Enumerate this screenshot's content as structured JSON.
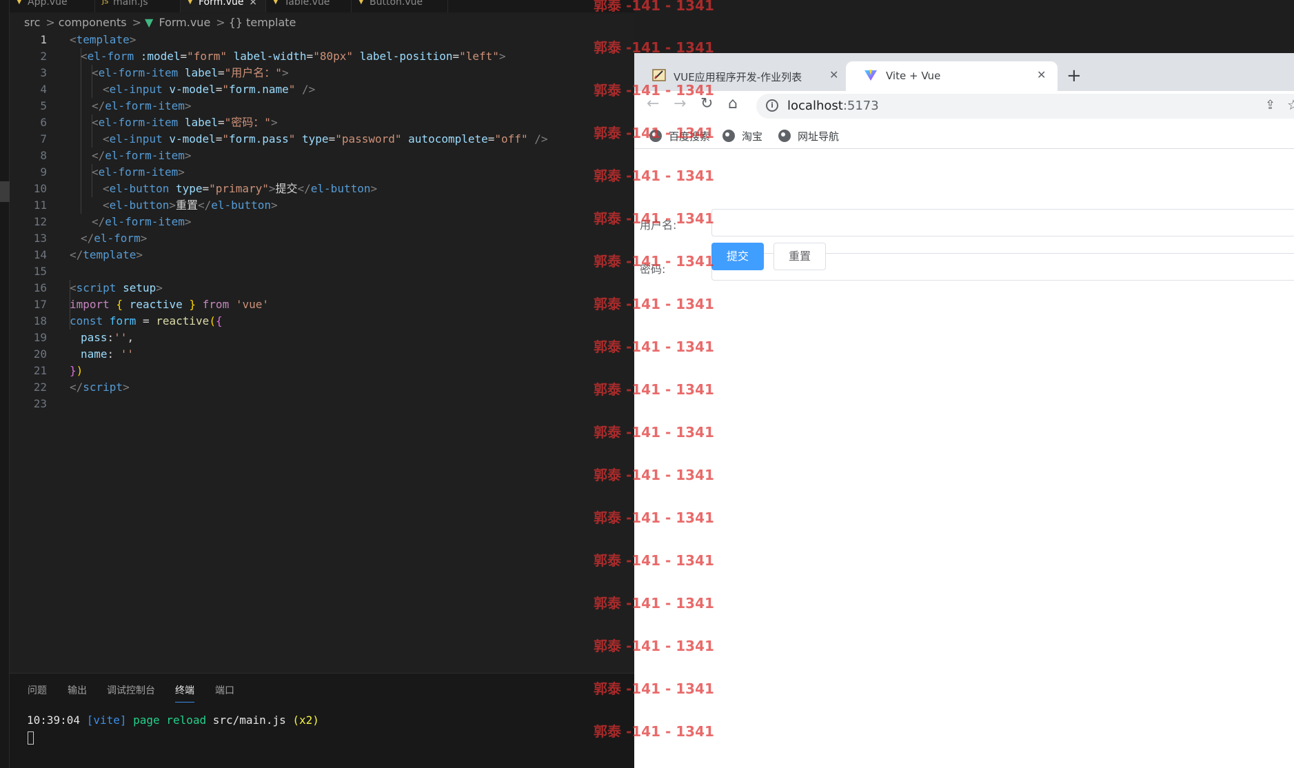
{
  "editor": {
    "tabs": [
      {
        "label": "App.vue"
      },
      {
        "label": "main.js"
      },
      {
        "label": "Form.vue",
        "close": "×"
      },
      {
        "label": "Table.vue"
      },
      {
        "label": "Button.vue"
      }
    ],
    "breadcrumb": {
      "parts": [
        "src",
        "components",
        "Form.vue",
        "{} template"
      ],
      "separator": ">"
    },
    "active_line": 1,
    "line_numbers": [
      "1",
      "2",
      "3",
      "4",
      "5",
      "6",
      "7",
      "8",
      "9",
      "10",
      "11",
      "12",
      "13",
      "14",
      "15",
      "16",
      "17",
      "18",
      "19",
      "20",
      "21",
      "22",
      "23"
    ],
    "code": {
      "l1": [
        "<",
        "template",
        ">"
      ],
      "l2": [
        "<",
        "el-form",
        " :model",
        "=",
        "\"form\"",
        " label-width",
        "=",
        "\"80px\"",
        " label-position",
        "=",
        "\"left\"",
        ">"
      ],
      "l3": [
        "<",
        "el-form-item",
        " label",
        "=",
        "\"用户名：\"",
        ">"
      ],
      "l4": [
        "<",
        "el-input",
        " v-model",
        "=",
        "\"",
        "form.name",
        "\"",
        " />"
      ],
      "l5": [
        "</",
        "el-form-item",
        ">"
      ],
      "l6": [
        "<",
        "el-form-item",
        " label",
        "=",
        "\"密码：\"",
        ">"
      ],
      "l7": [
        "<",
        "el-input",
        " v-model",
        "=",
        "\"",
        "form.pass",
        "\"",
        " type",
        "=",
        "\"password\"",
        " autocomplete",
        "=",
        "\"off\"",
        " />"
      ],
      "l8": [
        "</",
        "el-form-item",
        ">"
      ],
      "l9": [
        "<",
        "el-form-item",
        ">"
      ],
      "l10": [
        "<",
        "el-button",
        " type",
        "=",
        "\"primary\"",
        ">",
        "提交",
        "</",
        "el-button",
        ">"
      ],
      "l11": [
        "<",
        "el-button",
        ">",
        "重置",
        "</",
        "el-button",
        ">"
      ],
      "l12": [
        "</",
        "el-form-item",
        ">"
      ],
      "l13": [
        "</",
        "el-form",
        ">"
      ],
      "l14": [
        "</",
        "template",
        ">"
      ],
      "l16": [
        "<",
        "script",
        " setup",
        ">"
      ],
      "l17": [
        "import",
        " {",
        " reactive",
        " }",
        " from",
        " 'vue'"
      ],
      "l18": [
        "const",
        " form",
        " =",
        " reactive",
        "(",
        "{"
      ],
      "l19": [
        "pass",
        ":",
        "''",
        ","
      ],
      "l20": [
        "name",
        ": ",
        "''"
      ],
      "l21": [
        "}",
        ")"
      ],
      "l22": [
        "</",
        "script",
        ">"
      ]
    }
  },
  "panel": {
    "tabs": [
      "问题",
      "输出",
      "调试控制台",
      "终端",
      "端口"
    ],
    "active_tab": "终端",
    "terminal": {
      "time": "10:39:04",
      "tag": "[vite]",
      "message": "page reload",
      "file": "src/main.js",
      "count": "(x2)"
    }
  },
  "browser": {
    "tabs": [
      {
        "title": "VUE应用程序开发-作业列表",
        "close": "✕"
      },
      {
        "title": "Vite + Vue",
        "close": "✕"
      }
    ],
    "new_tab": "+",
    "nav": {
      "back": "←",
      "forward": "→",
      "reload": "↻",
      "home": "⌂"
    },
    "address": {
      "host": "localhost",
      "port": ":5173",
      "info_icon": "i"
    },
    "toolbar_icons": [
      "share-icon",
      "star-icon"
    ],
    "bookmarks": [
      "百度搜索",
      "淘宝",
      "网址导航"
    ]
  },
  "page": {
    "form": {
      "username_label": "用户名:",
      "password_label": "密码:",
      "username_value": "",
      "password_value": "",
      "submit_label": "提交",
      "reset_label": "重置"
    }
  },
  "watermark": {
    "text": "郭泰 -141 - 1341",
    "color": "#e03030"
  },
  "colors": {
    "primary_button": "#409eff",
    "editor_bg": "#1f1f1f",
    "vue_green": "#41b883"
  }
}
